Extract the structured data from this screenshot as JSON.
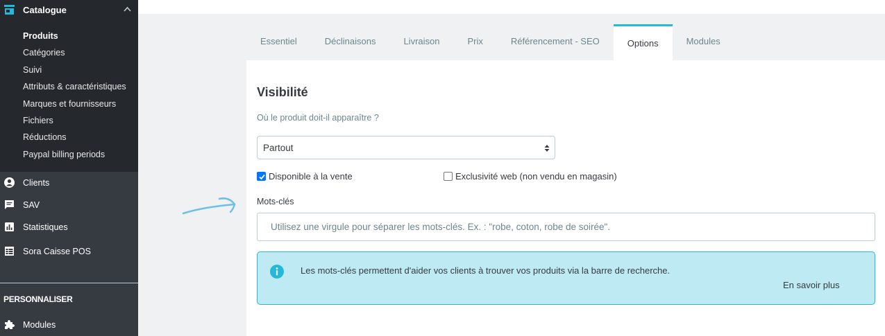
{
  "sidebar": {
    "catalogue": {
      "title": "Catalogue",
      "items": [
        {
          "label": "Produits",
          "active": true
        },
        {
          "label": "Catégories"
        },
        {
          "label": "Suivi"
        },
        {
          "label": "Attributs & caractéristiques"
        },
        {
          "label": "Marques et fournisseurs"
        },
        {
          "label": "Fichiers"
        },
        {
          "label": "Réductions"
        },
        {
          "label": "Paypal billing periods"
        }
      ]
    },
    "nav": [
      {
        "label": "Clients",
        "icon": "user-icon"
      },
      {
        "label": "SAV",
        "icon": "chat-icon"
      },
      {
        "label": "Statistiques",
        "icon": "chart-icon"
      },
      {
        "label": "Sora Caisse POS",
        "icon": "grid-icon"
      }
    ],
    "section_title": "PERSONNALISER",
    "section_items": [
      {
        "label": "Modules",
        "icon": "puzzle-icon"
      }
    ]
  },
  "tabs": [
    {
      "label": "Essentiel"
    },
    {
      "label": "Déclinaisons"
    },
    {
      "label": "Livraison"
    },
    {
      "label": "Prix"
    },
    {
      "label": "Référencement - SEO"
    },
    {
      "label": "Options",
      "active": true
    },
    {
      "label": "Modules"
    }
  ],
  "options": {
    "heading": "Visibilité",
    "visibility_question": "Où le produit doit-il apparaître ?",
    "visibility_select": {
      "value": "Partout"
    },
    "available_for_order": {
      "label": "Disponible à la vente",
      "checked": true
    },
    "web_exclusive": {
      "label": "Exclusivité web (non vendu en magasin)",
      "checked": false
    },
    "keywords": {
      "label": "Mots-clés",
      "placeholder": "Utilisez une virgule pour séparer les mots-clés. Ex. : \"robe, coton, robe de soirée\"."
    },
    "info_alert": {
      "text": "Les mots-clés permettent d'aider vos clients à trouver vos produits via la barre de recherche.",
      "link": "En savoir plus"
    }
  },
  "colors": {
    "sidebar_bg": "#363a41",
    "sidebar_active_bg": "#25292e",
    "accent": "#25b9d7",
    "alert_bg": "#beeaf3"
  }
}
